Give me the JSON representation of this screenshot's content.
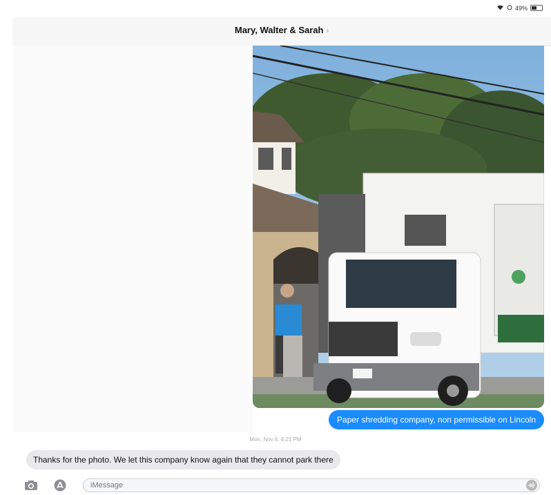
{
  "status_bar": {
    "battery_text": "49%",
    "battery_level": 0.49
  },
  "header": {
    "title": "Mary, Walter & Sarah",
    "chevron": "›"
  },
  "messages": {
    "sent_text": "Paper shredding company, non permissible on Lincoln",
    "timestamp": "Mon, Nov 6, 4:21 PM",
    "received_text": "Thanks for the photo. We let this company know again that they cannot park there"
  },
  "input": {
    "placeholder": "iMessage"
  },
  "icons": {
    "camera": "camera-icon",
    "apps": "app-store-icon",
    "audio": "audio-waveform-icon",
    "wifi": "wifi-icon",
    "battery": "battery-icon"
  },
  "colors": {
    "sent_bubble": "#1a8cff",
    "received_bubble": "#e9e9eb",
    "header_bg": "#f7f7f7"
  }
}
